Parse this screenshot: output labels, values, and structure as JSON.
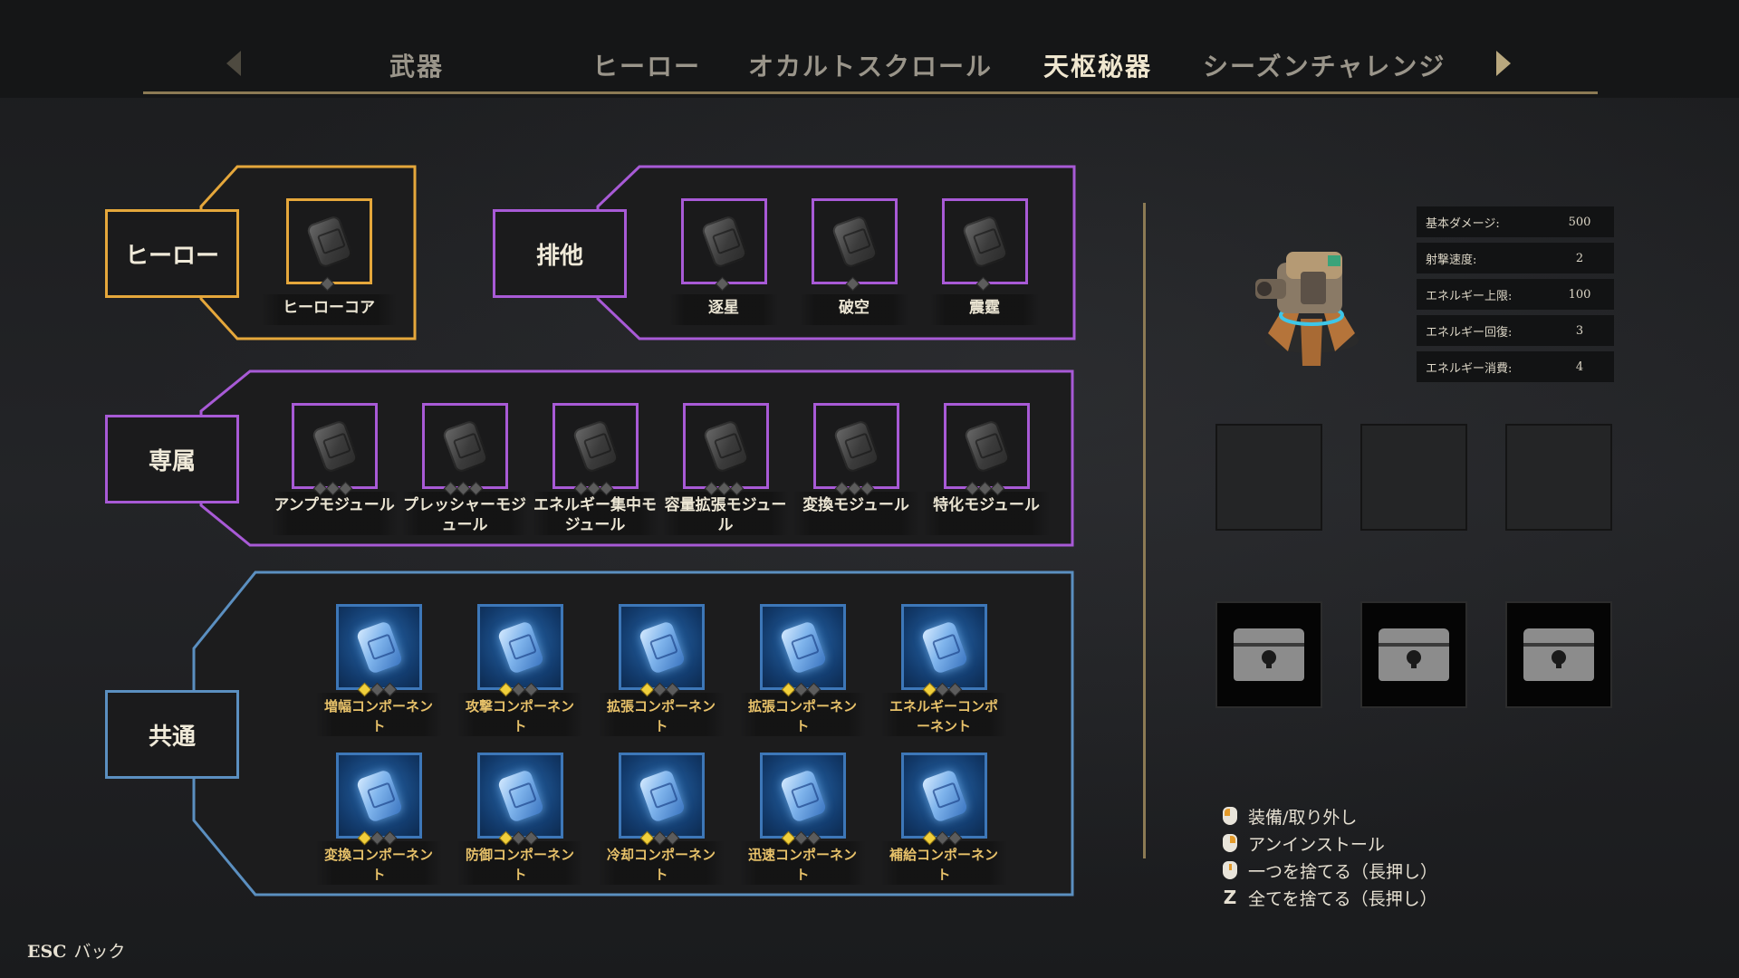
{
  "tabs": [
    {
      "label": "武器",
      "active": false
    },
    {
      "label": "ヒーロー",
      "active": false
    },
    {
      "label": "オカルトスクロール",
      "active": false
    },
    {
      "label": "天枢秘器",
      "active": true
    },
    {
      "label": "シーズンチャレンジ",
      "active": false
    }
  ],
  "categories": {
    "hero": {
      "label": "ヒーロー",
      "color": "#e5a73b"
    },
    "exclusive": {
      "label": "排他",
      "color": "#a85ad6"
    },
    "dedicated": {
      "label": "専属",
      "color": "#a85ad6"
    },
    "common": {
      "label": "共通",
      "color": "#5b8fc0"
    }
  },
  "hero_slots": [
    {
      "label": "ヒーローコア",
      "filled": 0,
      "total": 1
    }
  ],
  "exclusive_slots": [
    {
      "label": "逐星",
      "filled": 0,
      "total": 1
    },
    {
      "label": "破空",
      "filled": 0,
      "total": 1
    },
    {
      "label": "震霆",
      "filled": 0,
      "total": 1
    }
  ],
  "dedicated_slots": [
    {
      "label": "アンプモジュール",
      "filled": 0,
      "total": 3
    },
    {
      "label": "プレッシャーモジュール",
      "filled": 0,
      "total": 3
    },
    {
      "label": "エネルギー集中モジュール",
      "filled": 0,
      "total": 3
    },
    {
      "label": "容量拡張モジュール",
      "filled": 0,
      "total": 3
    },
    {
      "label": "変換モジュール",
      "filled": 0,
      "total": 3
    },
    {
      "label": "特化モジュール",
      "filled": 0,
      "total": 3
    }
  ],
  "common_slots": [
    {
      "label": "増幅コンポーネント",
      "filled": 1,
      "total": 3
    },
    {
      "label": "攻撃コンポーネント",
      "filled": 1,
      "total": 3
    },
    {
      "label": "拡張コンポーネント",
      "filled": 1,
      "total": 3
    },
    {
      "label": "拡張コンポーネント",
      "filled": 1,
      "total": 3
    },
    {
      "label": "エネルギーコンポーネント",
      "filled": 1,
      "total": 3
    },
    {
      "label": "変換コンポーネント",
      "filled": 1,
      "total": 3
    },
    {
      "label": "防御コンポーネント",
      "filled": 1,
      "total": 3
    },
    {
      "label": "冷却コンポーネント",
      "filled": 1,
      "total": 3
    },
    {
      "label": "迅速コンポーネント",
      "filled": 1,
      "total": 3
    },
    {
      "label": "補給コンポーネント",
      "filled": 1,
      "total": 3
    }
  ],
  "stats": [
    {
      "label": "基本ダメージ:",
      "value": "500"
    },
    {
      "label": "射撃速度:",
      "value": "2"
    },
    {
      "label": "エネルギー上限:",
      "value": "100"
    },
    {
      "label": "エネルギー回復:",
      "value": "3"
    },
    {
      "label": "エネルギー消費:",
      "value": "4"
    }
  ],
  "hints": [
    {
      "icon": "mouse-left-icon",
      "text": "装備/取り外し"
    },
    {
      "icon": "mouse-right-icon",
      "text": "アンインストール"
    },
    {
      "icon": "mouse-middle-icon",
      "text": "一つを捨てる（長押し）"
    },
    {
      "icon": "z-key-icon",
      "key": "Z",
      "text": "全てを捨てる（長押し）"
    }
  ],
  "esc": {
    "key": "ESC",
    "text": "バック"
  }
}
